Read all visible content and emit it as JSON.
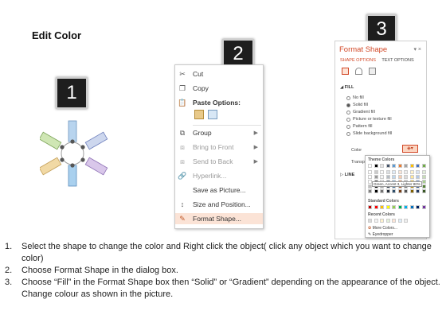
{
  "title": "Edit Color",
  "steps": [
    "1",
    "2",
    "3"
  ],
  "context_menu": {
    "items": [
      {
        "label": "Cut",
        "icon": "scissors-icon",
        "disabled": false
      },
      {
        "label": "Copy",
        "icon": "copy-icon",
        "disabled": false
      },
      {
        "label": "Paste Options:",
        "icon": "paste-icon",
        "disabled": false
      },
      {
        "label": "Group",
        "icon": "group-icon",
        "disabled": false
      },
      {
        "label": "Bring to Front",
        "icon": "bring-front-icon",
        "disabled": true
      },
      {
        "label": "Send to Back",
        "icon": "send-back-icon",
        "disabled": true
      },
      {
        "label": "Hyperlink...",
        "icon": "hyperlink-icon",
        "disabled": true
      },
      {
        "label": "Save as Picture...",
        "icon": "",
        "disabled": false
      },
      {
        "label": "Size and Position...",
        "icon": "size-icon",
        "disabled": false
      },
      {
        "label": "Format Shape...",
        "icon": "format-shape-icon",
        "disabled": false
      }
    ]
  },
  "format_pane": {
    "title": "Format Shape",
    "close": "▾ ×",
    "tabs": [
      "SHAPE OPTIONS",
      "TEXT OPTIONS"
    ],
    "section_fill": "FILL",
    "fill_options": [
      "No fill",
      "Solid fill",
      "Gradient fill",
      "Picture or texture fill",
      "Pattern fill",
      "Slide background fill"
    ],
    "selected_fill": "Solid fill",
    "color_label": "Color",
    "transparency_label": "Transpa",
    "section_line": "LINE"
  },
  "color_palette": {
    "theme_label": "Theme Colors",
    "tooltip": "Green, Accent 3, Lighter 80%",
    "standard_label": "Standard Colors",
    "recent_label": "Recent Colors",
    "more_colors": "More Colors...",
    "eyedropper": "Eyedropper",
    "theme_top_row": [
      "#ffffff",
      "#000000",
      "#e7e6e6",
      "#44546a",
      "#5b9bd5",
      "#ed7d31",
      "#a5a5a5",
      "#ffc000",
      "#4472c4",
      "#70ad47"
    ],
    "standard_colors": [
      "#c00000",
      "#ff0000",
      "#ffc000",
      "#ffff00",
      "#92d050",
      "#00b050",
      "#00b0f0",
      "#0070c0",
      "#002060",
      "#7030a0"
    ],
    "recent_colors": [
      "#d9d9d9",
      "#f2f2f2",
      "#fff2cc",
      "#e2efda",
      "#fce4d6",
      "#ddebf7",
      "#ededed"
    ]
  },
  "instructions": [
    {
      "num": "1.",
      "text": "Select the shape to change the color and Right click the object( click any object which you want to change color)"
    },
    {
      "num": "2.",
      "text": "Choose Format Shape in the dialog box."
    },
    {
      "num": "3.",
      "text": "Choose “Fill” in the Format Shape box then “Solid” or “Gradient” depending on the appearance of the object. Change colour as shown in the picture."
    }
  ]
}
